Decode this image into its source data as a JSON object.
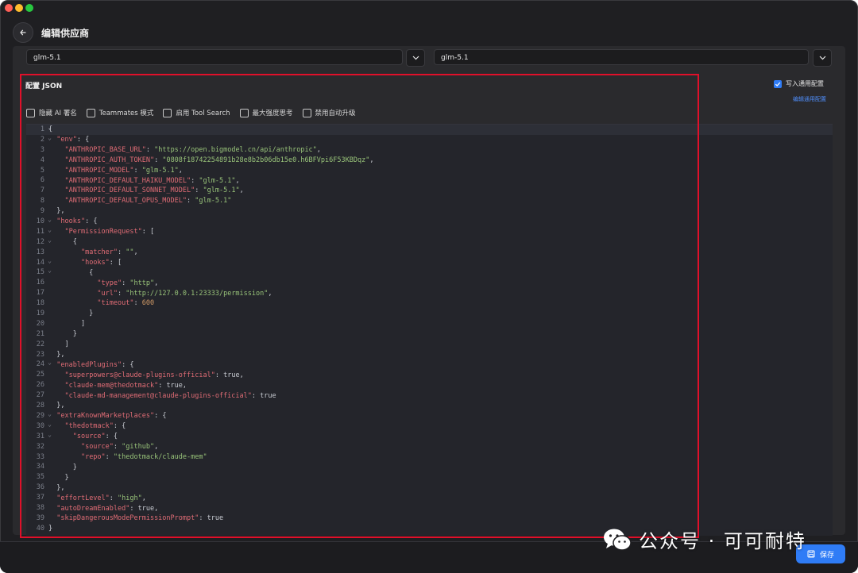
{
  "header": {
    "title": "编辑供应商"
  },
  "models": {
    "left_value": "glm-5.1",
    "right_value": "glm-5.1"
  },
  "config": {
    "label": "配置 JSON",
    "write_general_label": "写入通用配置",
    "write_general_checked": true,
    "edit_general_link": "编辑通用配置",
    "options": [
      {
        "label": "隐藏 AI 署名",
        "checked": false
      },
      {
        "label": "Teammates 模式",
        "checked": false
      },
      {
        "label": "启用 Tool Search",
        "checked": false
      },
      {
        "label": "最大强度思考",
        "checked": false
      },
      {
        "label": "禁用自动升级",
        "checked": false
      }
    ]
  },
  "editor": {
    "fold_lines": [
      1,
      2,
      10,
      11,
      12,
      14,
      15,
      24,
      29,
      30,
      31
    ],
    "lines": [
      "{",
      "  \"env\": {",
      "    \"ANTHROPIC_BASE_URL\": \"https://open.bigmodel.cn/api/anthropic\",",
      "    \"ANTHROPIC_AUTH_TOKEN\": \"0808f18742254891b28e8b2b06db15e0.h6BFVpi6F53KBDqz\",",
      "    \"ANTHROPIC_MODEL\": \"glm-5.1\",",
      "    \"ANTHROPIC_DEFAULT_HAIKU_MODEL\": \"glm-5.1\",",
      "    \"ANTHROPIC_DEFAULT_SONNET_MODEL\": \"glm-5.1\",",
      "    \"ANTHROPIC_DEFAULT_OPUS_MODEL\": \"glm-5.1\"",
      "  },",
      "  \"hooks\": {",
      "    \"PermissionRequest\": [",
      "      {",
      "        \"matcher\": \"\",",
      "        \"hooks\": [",
      "          {",
      "            \"type\": \"http\",",
      "            \"url\": \"http://127.0.0.1:23333/permission\",",
      "            \"timeout\": 600",
      "          }",
      "        ]",
      "      }",
      "    ]",
      "  },",
      "  \"enabledPlugins\": {",
      "    \"superpowers@claude-plugins-official\": true,",
      "    \"claude-mem@thedotmack\": true,",
      "    \"claude-md-management@claude-plugins-official\": true",
      "  },",
      "  \"extraKnownMarketplaces\": {",
      "    \"thedotmack\": {",
      "      \"source\": {",
      "        \"source\": \"github\",",
      "        \"repo\": \"thedotmack/claude-mem\"",
      "      }",
      "    }",
      "  },",
      "  \"effortLevel\": \"high\",",
      "  \"autoDreamEnabled\": true,",
      "  \"skipDangerousModePermissionPrompt\": true",
      "}"
    ]
  },
  "footer": {
    "save_label": "保存"
  },
  "watermark": {
    "text": "公众号 · 可可耐特"
  },
  "colors": {
    "accent": "#2f7cf6",
    "highlight_box": "#e0102a",
    "json_key": "#e06c75",
    "json_string": "#98c379",
    "json_number": "#d19a66"
  }
}
